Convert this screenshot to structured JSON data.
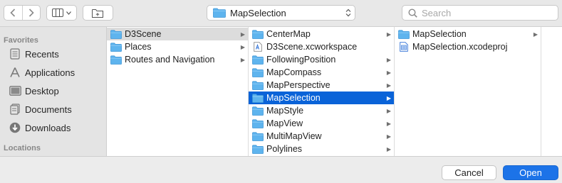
{
  "toolbar": {
    "back_icon": "chevron-left-icon",
    "forward_icon": "chevron-right-icon",
    "view_icon": "column-view-icon",
    "new_folder_icon": "new-folder-icon",
    "path_popup_label": "MapSelection",
    "search_placeholder": "Search"
  },
  "sidebar": {
    "favorites_heading": "Favorites",
    "locations_heading": "Locations",
    "items": [
      {
        "label": "Recents",
        "icon": "clock-icon"
      },
      {
        "label": "Applications",
        "icon": "applications-icon"
      },
      {
        "label": "Desktop",
        "icon": "desktop-icon"
      },
      {
        "label": "Documents",
        "icon": "document-icon"
      },
      {
        "label": "Downloads",
        "icon": "download-icon"
      }
    ]
  },
  "columns": {
    "col1": [
      {
        "name": "D3Scene",
        "type": "folder"
      },
      {
        "name": "Places",
        "type": "folder"
      },
      {
        "name": "Routes and Navigation",
        "type": "folder"
      }
    ],
    "col2": [
      {
        "name": "CenterMap",
        "type": "folder"
      },
      {
        "name": "D3Scene.xcworkspace",
        "type": "file"
      },
      {
        "name": "FollowingPosition",
        "type": "folder"
      },
      {
        "name": "MapCompass",
        "type": "folder"
      },
      {
        "name": "MapPerspective",
        "type": "folder"
      },
      {
        "name": "MapSelection",
        "type": "folder"
      },
      {
        "name": "MapStyle",
        "type": "folder"
      },
      {
        "name": "MapView",
        "type": "folder"
      },
      {
        "name": "MultiMapView",
        "type": "folder"
      },
      {
        "name": "Polylines",
        "type": "folder"
      }
    ],
    "col3": [
      {
        "name": "MapSelection",
        "type": "folder"
      },
      {
        "name": "MapSelection.xcodeproj",
        "type": "file"
      }
    ]
  },
  "buttons": {
    "cancel": "Cancel",
    "open": "Open"
  },
  "colors": {
    "selection": "#0a63d8",
    "folder": "#5eb4ee",
    "primary_button": "#1c73e8"
  }
}
